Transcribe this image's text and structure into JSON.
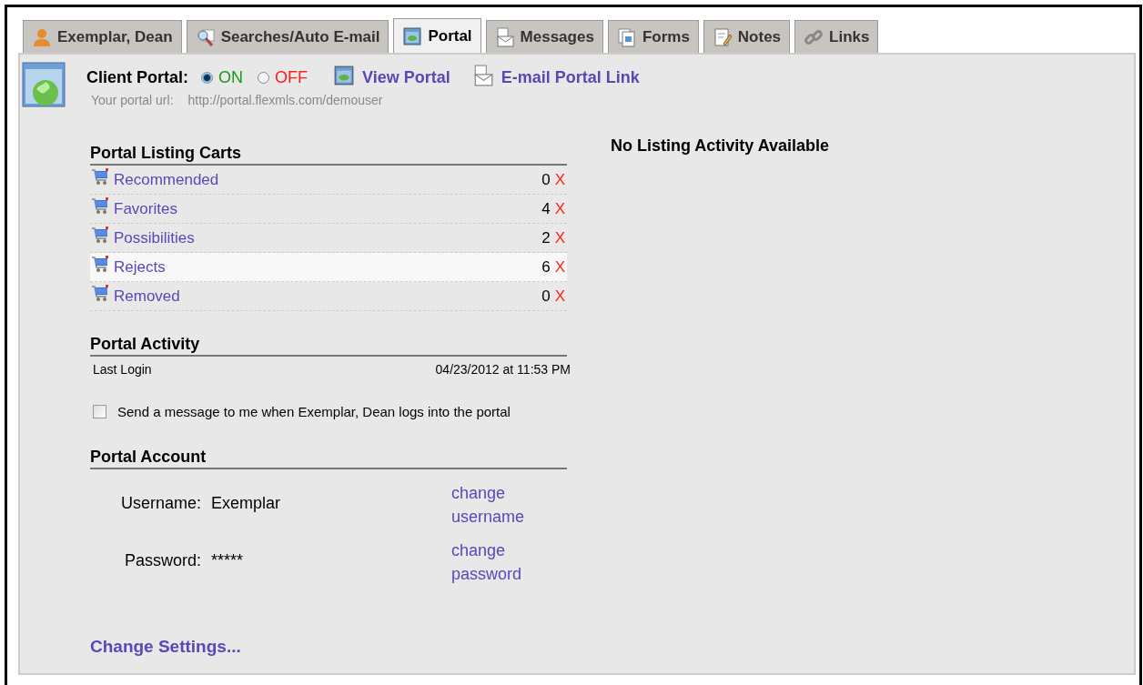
{
  "tabs": [
    {
      "label": "Exemplar, Dean",
      "selected": false
    },
    {
      "label": "Searches/Auto E-mail",
      "selected": false
    },
    {
      "label": "Portal",
      "selected": true
    },
    {
      "label": "Messages",
      "selected": false
    },
    {
      "label": "Forms",
      "selected": false
    },
    {
      "label": "Notes",
      "selected": false
    },
    {
      "label": "Links",
      "selected": false
    }
  ],
  "client_portal": {
    "label": "Client Portal:",
    "options": [
      {
        "label": "ON",
        "selected": true,
        "color": "#1a9a1a"
      },
      {
        "label": "OFF",
        "selected": false,
        "color": "#ff1a1a"
      }
    ],
    "links": [
      "View Portal",
      "E-mail Portal Link"
    ],
    "url_label": "Your portal url:",
    "url": "http://portal.flexmls.com/demouser"
  },
  "listing_carts": {
    "title": "Portal Listing Carts",
    "items": [
      {
        "name": "Recommended",
        "count": "0",
        "remove": "X",
        "highlighted": false
      },
      {
        "name": "Favorites",
        "count": "4",
        "remove": "X",
        "highlighted": false
      },
      {
        "name": "Possibilities",
        "count": "2",
        "remove": "X",
        "highlighted": false
      },
      {
        "name": "Rejects",
        "count": "6",
        "remove": "X",
        "highlighted": true
      },
      {
        "name": "Removed",
        "count": "0",
        "remove": "X",
        "highlighted": false
      }
    ]
  },
  "activity": {
    "title": "Portal Activity",
    "last_login_label": "Last Login",
    "last_login": "04/23/2012 at 11:53 PM",
    "notify": {
      "label": "Send a message to me when Exemplar, Dean logs into the portal",
      "checked": false
    }
  },
  "account": {
    "title": "Portal Account",
    "rows": [
      {
        "label": "Username:",
        "value": "Exemplar",
        "link": [
          "change",
          "username"
        ]
      },
      {
        "label": "Password:",
        "value": "*****",
        "link": [
          "change",
          "password"
        ]
      }
    ]
  },
  "change_settings": "Change Settings...",
  "listing_activity": "No Listing Activity Available"
}
